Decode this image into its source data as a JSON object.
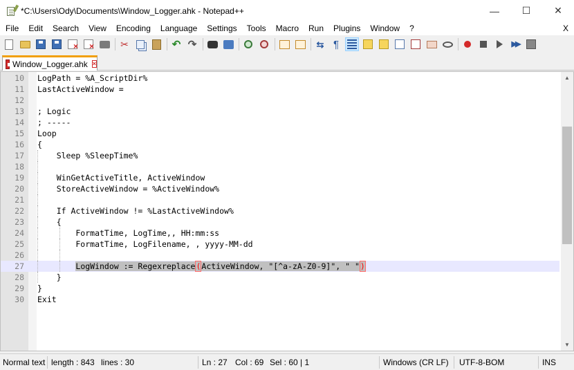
{
  "window": {
    "title": "*C:\\Users\\Ody\\Documents\\Window_Logger.ahk - Notepad++",
    "minimize": "—",
    "maximize": "☐",
    "close": "✕"
  },
  "menu": {
    "items": [
      "File",
      "Edit",
      "Search",
      "View",
      "Encoding",
      "Language",
      "Settings",
      "Tools",
      "Macro",
      "Run",
      "Plugins",
      "Window",
      "?"
    ],
    "close_doc": "X"
  },
  "toolbar": {
    "icons": [
      "new-file-icon",
      "open-file-icon",
      "save-icon",
      "save-all-icon",
      "close-icon",
      "close-all-icon",
      "print-icon",
      "cut-icon",
      "copy-icon",
      "paste-icon",
      "undo-icon",
      "redo-icon",
      "find-icon",
      "replace-icon",
      "zoom-in-icon",
      "zoom-out-icon",
      "sync-vertical-icon",
      "sync-horizontal-icon",
      "word-wrap-icon",
      "show-all-chars-icon",
      "indent-guide-icon",
      "language-note-icon",
      "doc-map-icon",
      "function-list-icon",
      "folder-as-workspace-icon",
      "monitoring-icon",
      "record-macro-icon",
      "stop-macro-icon",
      "play-macro-icon",
      "run-macro-multiple-icon",
      "save-macro-icon"
    ],
    "active_icon": "indent-guide-icon"
  },
  "tab": {
    "label": "Window_Logger.ahk",
    "close": "×"
  },
  "editor": {
    "current_line": 27,
    "lines": [
      {
        "num": "10",
        "text": "LogPath = %A_ScriptDir%",
        "indent": 0
      },
      {
        "num": "11",
        "text": "LastActiveWindow =",
        "indent": 0
      },
      {
        "num": "12",
        "text": "",
        "indent": 0
      },
      {
        "num": "13",
        "text": "; Logic",
        "indent": 0
      },
      {
        "num": "14",
        "text": "; -----",
        "indent": 0
      },
      {
        "num": "15",
        "text": "Loop",
        "indent": 0
      },
      {
        "num": "16",
        "text": "{",
        "indent": 0
      },
      {
        "num": "17",
        "text": "    Sleep %SleepTime%",
        "indent": 1
      },
      {
        "num": "18",
        "text": "",
        "indent": 1
      },
      {
        "num": "19",
        "text": "    WinGetActiveTitle, ActiveWindow",
        "indent": 1
      },
      {
        "num": "20",
        "text": "    StoreActiveWindow = %ActiveWindow%",
        "indent": 1
      },
      {
        "num": "21",
        "text": "",
        "indent": 1
      },
      {
        "num": "22",
        "text": "    If ActiveWindow != %LastActiveWindow%",
        "indent": 1
      },
      {
        "num": "23",
        "text": "    {",
        "indent": 1
      },
      {
        "num": "24",
        "text": "        FormatTime, LogTime,, HH:mm:ss",
        "indent": 2
      },
      {
        "num": "25",
        "text": "        FormatTime, LogFilename, , yyyy-MM-dd",
        "indent": 2
      },
      {
        "num": "26",
        "text": "",
        "indent": 2
      },
      {
        "num": "27",
        "text": "        LogWindow := Regexreplace(ActiveWindow, \"[^a-zA-Z0-9]\", \" \")",
        "indent": 2
      },
      {
        "num": "28",
        "text": "    }",
        "indent": 1
      },
      {
        "num": "29",
        "text": "}",
        "indent": 0
      },
      {
        "num": "30",
        "text": "Exit",
        "indent": 0
      }
    ],
    "selected_line": {
      "indent": "        ",
      "before_brace": "LogWindow := Regexreplace",
      "open_brace": "(",
      "middle": "ActiveWindow, \"[^a-zA-Z0-9]\", \" \"",
      "close_brace": ")"
    }
  },
  "status": {
    "file_type": "Normal text",
    "length": "length : 843",
    "lines": "lines : 30",
    "ln": "Ln : 27",
    "col": "Col : 69",
    "sel": "Sel : 60 | 1",
    "eol": "Windows (CR LF)",
    "encoding": "UTF-8-BOM",
    "mode": "INS"
  }
}
